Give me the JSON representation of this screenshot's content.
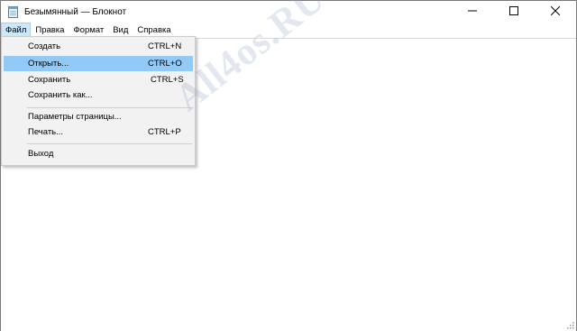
{
  "window": {
    "title": "Безымянный — Блокнот",
    "icon": "notepad-icon",
    "controls": [
      "minimize-icon",
      "maximize-icon",
      "close-icon"
    ]
  },
  "menubar": {
    "items": [
      {
        "label": "Файл",
        "active": true
      },
      {
        "label": "Правка"
      },
      {
        "label": "Формат"
      },
      {
        "label": "Вид"
      },
      {
        "label": "Справка"
      }
    ]
  },
  "file_menu": {
    "items": [
      {
        "label": "Создать",
        "shortcut": "CTRL+N"
      },
      {
        "label": "Открыть...",
        "shortcut": "CTRL+O",
        "highlighted": true
      },
      {
        "label": "Сохранить",
        "shortcut": "CTRL+S"
      },
      {
        "label": "Сохранить как...",
        "shortcut": ""
      },
      {
        "label": "Параметры страницы...",
        "shortcut": ""
      },
      {
        "label": "Печать...",
        "shortcut": "CTRL+P"
      },
      {
        "label": "Выход",
        "shortcut": ""
      }
    ]
  },
  "watermark": {
    "text": "All4os.RU"
  },
  "colors": {
    "menu_active_bg": "#cce8ff",
    "menu_highlight": "#91c9f7",
    "dropdown_bg": "#f2f2f2"
  }
}
